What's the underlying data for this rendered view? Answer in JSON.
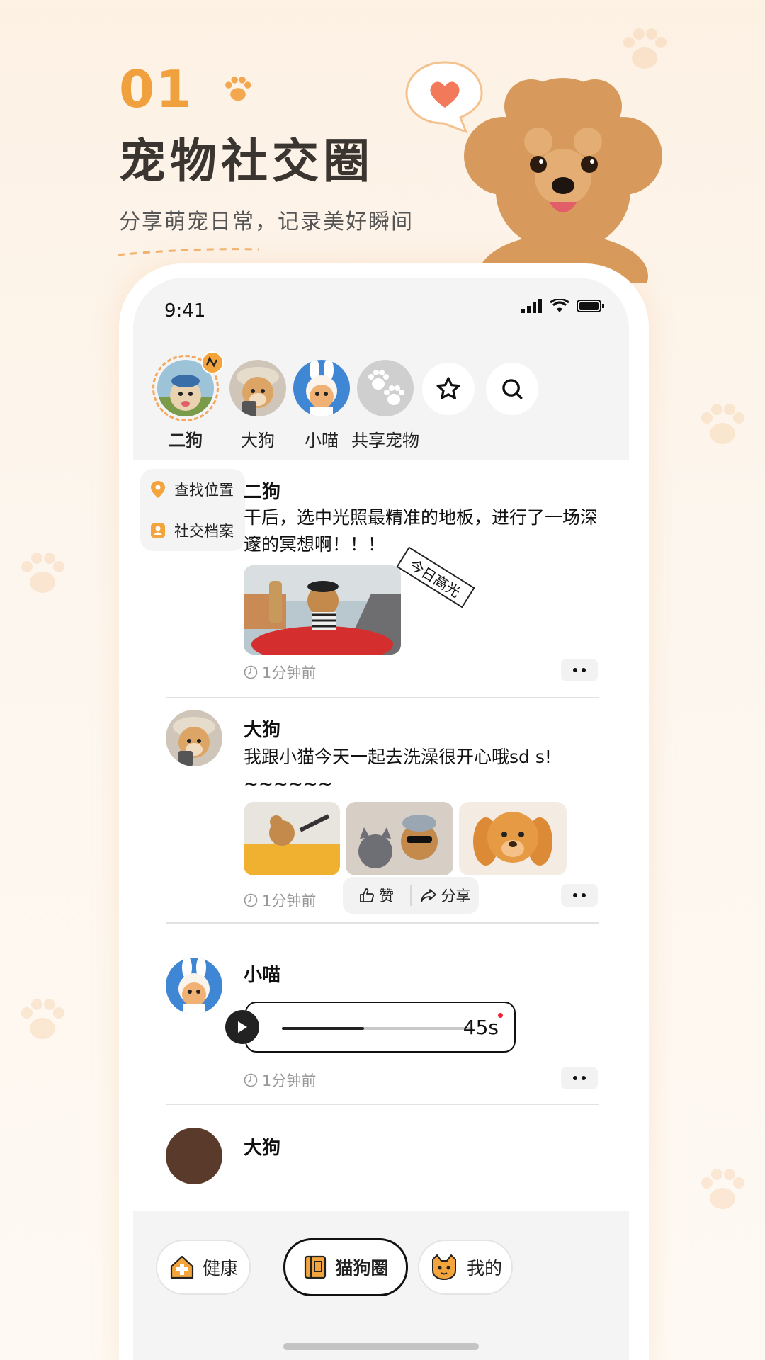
{
  "hero": {
    "number": "01",
    "title": "宠物社交圈",
    "subtitle": "分享萌宠日常，记录美好瞬间"
  },
  "status_bar": {
    "time": "9:41"
  },
  "pets": [
    {
      "name": "二狗",
      "active": true
    },
    {
      "name": "大狗",
      "active": false
    },
    {
      "name": "小喵",
      "active": false
    },
    {
      "name": "共享宠物",
      "active": false
    }
  ],
  "side_menu": {
    "locate": "查找位置",
    "profile": "社交档案"
  },
  "posts": [
    {
      "author": "二狗",
      "text": "干后，选中光照最精准的地板，进行了一场深邃的冥想啊！！！",
      "tag": "今日高光",
      "time": "1分钟前"
    },
    {
      "author": "大狗",
      "text": "我跟小猫今天一起去洗澡很开心哦sd s! ~~~~~~",
      "time": "1分钟前",
      "like_label": "赞",
      "share_label": "分享"
    },
    {
      "author": "小喵",
      "voice_duration": "45s",
      "voice_progress": 0.43,
      "time": "1分钟前"
    },
    {
      "author": "大狗"
    }
  ],
  "bottom_nav": {
    "health": "健康",
    "circle": "猫狗圈",
    "mine": "我的"
  },
  "colors": {
    "accent": "#f0a03c",
    "background": "#fdf3e8"
  }
}
